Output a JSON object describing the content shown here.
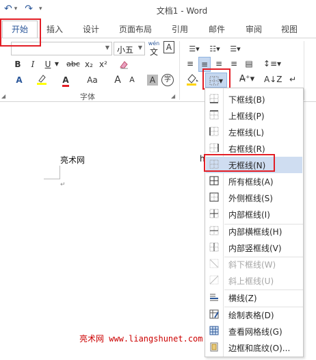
{
  "app": {
    "title": "文档1 - Word"
  },
  "tabs": [
    {
      "label": "开始"
    },
    {
      "label": "插入"
    },
    {
      "label": "设计"
    },
    {
      "label": "页面布局"
    },
    {
      "label": "引用"
    },
    {
      "label": "邮件"
    },
    {
      "label": "审阅"
    },
    {
      "label": "视图"
    }
  ],
  "ribbon": {
    "font_size": "小五",
    "wen_label": "wén",
    "wen_char": "文",
    "a_box": "A",
    "bold": "B",
    "italic": "I",
    "underline": "U",
    "strike": "abc",
    "subscript": "x₂",
    "superscript": "x²",
    "font_group_label": "字体",
    "grow": "A",
    "shrink": "A",
    "case": "Aa",
    "char_shade": "A",
    "enclose": "字"
  },
  "document": {
    "line1": "亮术网",
    "partial": "h"
  },
  "menu": {
    "items": [
      {
        "label": "下框线(B)",
        "icon": "border-bottom-icon",
        "disabled": false
      },
      {
        "label": "上框线(P)",
        "icon": "border-top-icon",
        "disabled": false
      },
      {
        "label": "左框线(L)",
        "icon": "border-left-icon",
        "disabled": false
      },
      {
        "label": "右框线(R)",
        "icon": "border-right-icon",
        "disabled": false
      },
      {
        "label": "无框线(N)",
        "icon": "border-none-icon",
        "disabled": false,
        "highlighted": true
      },
      {
        "label": "所有框线(A)",
        "icon": "border-all-icon",
        "disabled": false
      },
      {
        "label": "外侧框线(S)",
        "icon": "border-outside-icon",
        "disabled": false
      },
      {
        "label": "内部框线(I)",
        "icon": "border-inside-icon",
        "disabled": false
      },
      {
        "label": "内部横框线(H)",
        "icon": "border-inside-horizontal-icon",
        "disabled": false
      },
      {
        "label": "内部竖框线(V)",
        "icon": "border-inside-vertical-icon",
        "disabled": false
      },
      {
        "label": "斜下框线(W)",
        "icon": "diagonal-down-border-icon",
        "disabled": true
      },
      {
        "label": "斜上框线(U)",
        "icon": "diagonal-up-border-icon",
        "disabled": true
      },
      {
        "label": "横线(Z)",
        "icon": "horizontal-line-icon",
        "disabled": false
      },
      {
        "label": "绘制表格(D)",
        "icon": "draw-table-icon",
        "disabled": false
      },
      {
        "label": "查看网格线(G)",
        "icon": "view-gridlines-icon",
        "disabled": false
      },
      {
        "label": "边框和底纹(O)...",
        "icon": "borders-shading-icon",
        "disabled": false
      }
    ]
  },
  "watermark": "亮术网 www.liangshunet.com",
  "colors": {
    "accent": "#2b579a",
    "highlight_box": "#e21d25",
    "menu_hover": "#cfddf1",
    "watermark": "#cc0000"
  }
}
